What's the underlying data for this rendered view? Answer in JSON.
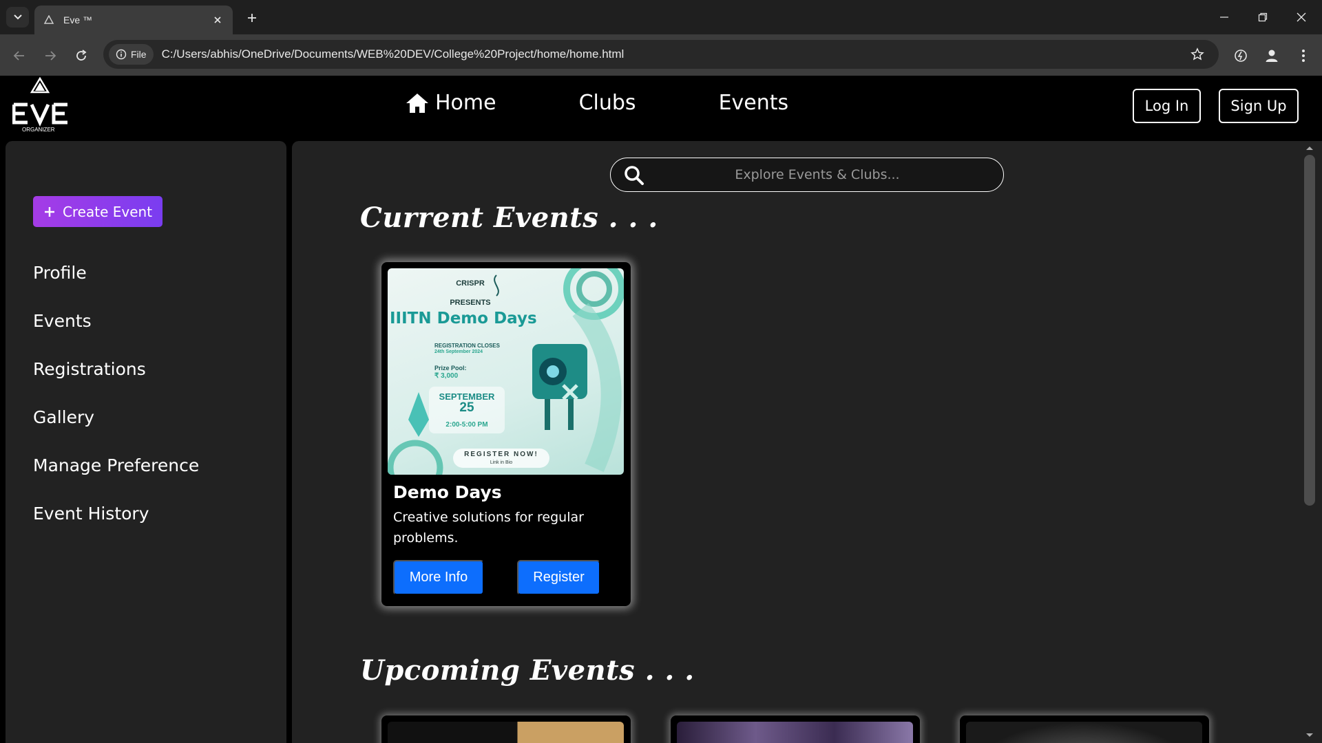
{
  "browser": {
    "tab_title": "Eve ™",
    "site_chip": "File",
    "url": "C:/Users/abhis/OneDrive/Documents/WEB%20DEV/College%20Project/home/home.html"
  },
  "header": {
    "logo_text": "EVE",
    "logo_sub": "ORGANIZER",
    "nav": {
      "home": "Home",
      "clubs": "Clubs",
      "events": "Events"
    },
    "login": "Log In",
    "signup": "Sign Up"
  },
  "sidebar": {
    "create_event": "Create Event",
    "items": [
      "Profile",
      "Events",
      "Registrations",
      "Gallery",
      "Manage Preference",
      "Event History"
    ]
  },
  "main": {
    "search_placeholder": "Explore Events & Clubs...",
    "current_title": "Current Events . . .",
    "upcoming_title": "Upcoming Events . . .",
    "current_events": [
      {
        "title": "Demo Days",
        "description": "Creative solutions for regular problems.",
        "more_info": "More Info",
        "register": "Register",
        "poster": {
          "club": "CRISPR",
          "presents": "PRESENTS",
          "headline": "IIITN Demo Days",
          "reg_label": "REGISTRATION CLOSES",
          "reg_date": "24th September 2024",
          "prize_label": "Prize Pool:",
          "prize_value": "₹ 3,000",
          "month": "SEPTEMBER",
          "day": "25",
          "time": "2:00-5:00 PM",
          "cta": "REGISTER NOW!",
          "cta_sub": "Link in Bio"
        }
      }
    ]
  },
  "colors": {
    "accent_blue": "#0d6efd",
    "create_gradient_start": "#a53ce6",
    "create_gradient_end": "#7a3df0",
    "panel": "#222222"
  }
}
